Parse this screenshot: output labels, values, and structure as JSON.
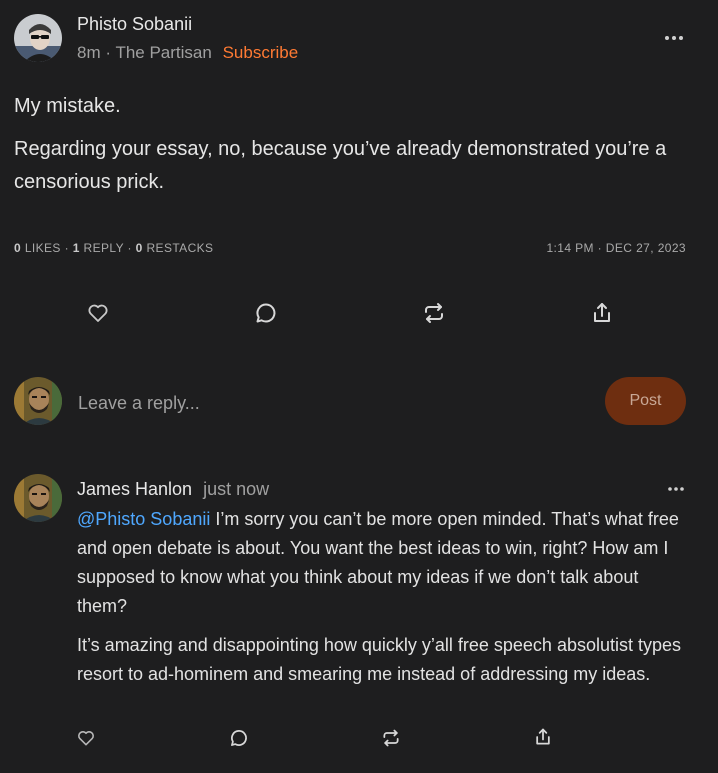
{
  "post": {
    "author": "Phisto Sobanii",
    "age": "8m",
    "separator": "·",
    "publication": "The Partisan",
    "subscribe_label": "Subscribe",
    "paragraphs": [
      "My mistake.",
      "Regarding your essay, no, because you’ve already demonstrated you’re a censorious prick."
    ],
    "stats": {
      "likes_count": "0",
      "likes_label": "LIKES",
      "replies_count": "1",
      "replies_label": "REPLY",
      "restacks_count": "0",
      "restacks_label": "RESTACKS",
      "dot": "·",
      "timestamp": "1:14 PM · DEC 27, 2023"
    }
  },
  "reply_box": {
    "placeholder": "Leave a reply...",
    "post_label": "Post"
  },
  "comment": {
    "author": "James Hanlon",
    "age": "just now",
    "mention": "@Phisto Sobanii",
    "paragraph1": " I’m sorry you can’t be more open minded. That’s what free and open debate is about. You want the best ideas to win, right? How am I supposed to know what you think about my ideas if we don’t talk about them?",
    "paragraph2": "It’s amazing and disappointing how quickly y’all free speech absolutist types resort to ad-hominem and smearing me instead of addressing my ideas."
  },
  "icons": {
    "more": "more-horizontal-icon",
    "like": "heart-icon",
    "comment": "comment-bubble-icon",
    "restack": "restack-icon",
    "share": "share-icon"
  },
  "colors": {
    "background": "#1e1e1f",
    "accent": "#ff7a33",
    "mention": "#4fa8ff",
    "post_button": "#6e2e10"
  }
}
